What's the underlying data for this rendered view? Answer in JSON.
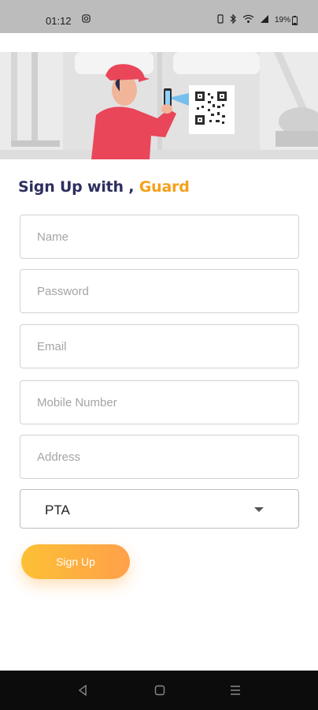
{
  "status_bar": {
    "time": "01:12",
    "left_icon": "instagram-icon",
    "right_icons": [
      "vibrate-icon",
      "bluetooth-icon",
      "wifi-icon",
      "signal-icon"
    ],
    "battery": "19%"
  },
  "hero": {
    "image": "guard-scanning-qr-illustration"
  },
  "heading": {
    "main": "Sign Up with , ",
    "accent": "Guard"
  },
  "form": {
    "name_placeholder": "Name",
    "password_placeholder": "Password",
    "email_placeholder": "Email",
    "mobile_placeholder": "Mobile Number",
    "address_placeholder": "Address",
    "select_value": "PTA"
  },
  "button": {
    "signup_label": "Sign Up"
  },
  "colors": {
    "heading": "#2d2f5e",
    "accent": "#f4a11a",
    "button_start": "#fcc035",
    "button_end": "#ffa04a",
    "figure_red": "#e9465a"
  },
  "nav": [
    "back-icon",
    "home-icon",
    "recent-apps-icon"
  ]
}
